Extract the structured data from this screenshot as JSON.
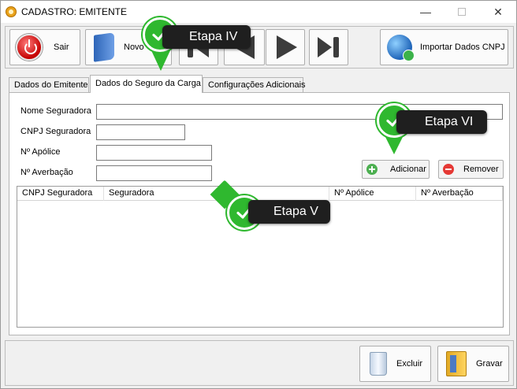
{
  "window": {
    "title": "CADASTRO: EMITENTE",
    "minimize": "—",
    "close": "✕"
  },
  "toolbar": {
    "sair_label": "Sair",
    "novo_label": "Novo",
    "importar_label": "Importar Dados CNPJ"
  },
  "tabs": [
    {
      "label": "Dados do Emitente",
      "active": false
    },
    {
      "label": "Dados do Seguro da Carga",
      "active": true
    },
    {
      "label": "Configurações Adicionais",
      "active": false
    }
  ],
  "form": {
    "nome_seguradora": {
      "label": "Nome Seguradora",
      "value": ""
    },
    "cnpj_seguradora": {
      "label": "CNPJ Seguradora",
      "value": ""
    },
    "apolice": {
      "label": "Nº Apólice",
      "value": ""
    },
    "averbacao": {
      "label": "Nº Averbação",
      "value": ""
    }
  },
  "actions": {
    "adicionar_label": "Adicionar",
    "remover_label": "Remover"
  },
  "grid": {
    "columns": [
      "CNPJ Seguradora",
      "Seguradora",
      "Nº Apólice",
      "Nº Averbação"
    ],
    "rows": []
  },
  "bottom": {
    "excluir_label": "Excluir",
    "gravar_label": "Gravar"
  },
  "callouts": {
    "etapa_iv": "Etapa IV",
    "etapa_v": "Etapa V",
    "etapa_vi": "Etapa VI"
  },
  "colors": {
    "callout_bg": "#1f1f1f",
    "check_green": "#2fb82f",
    "power_red": "#c40000"
  }
}
